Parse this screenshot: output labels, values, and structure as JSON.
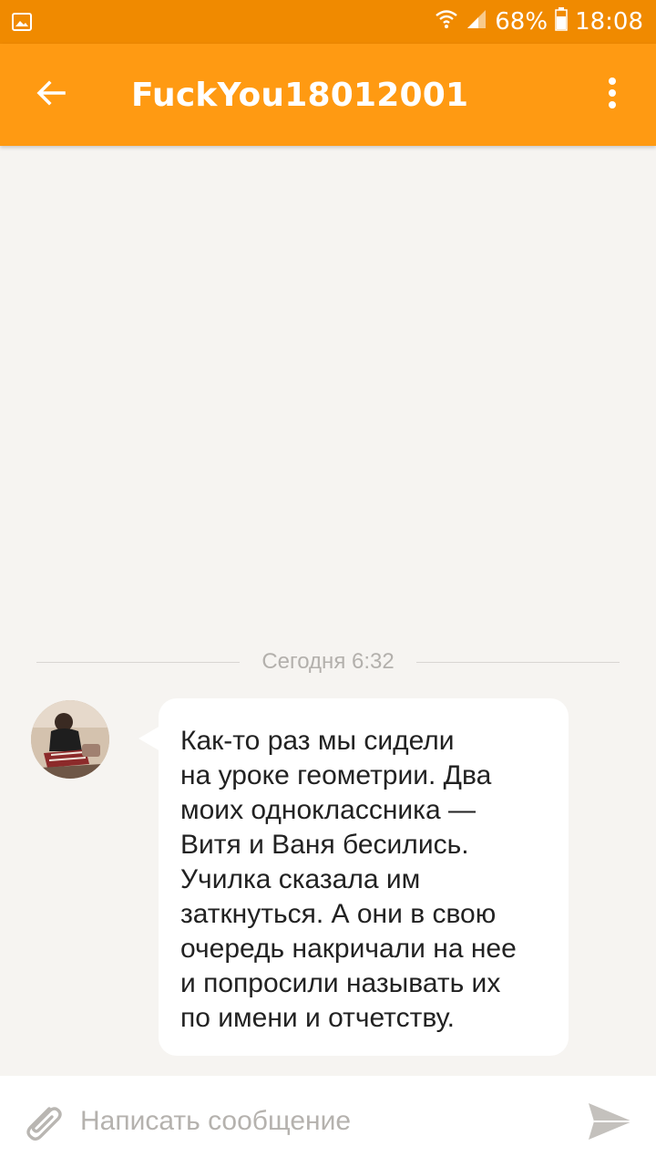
{
  "status_bar": {
    "battery": "68%",
    "time": "18:08",
    "icons": [
      "image-notification-icon",
      "wifi-icon",
      "signal-icon",
      "battery-icon"
    ]
  },
  "header": {
    "title": "FuckYou18012001",
    "back_icon": "back-arrow-icon",
    "menu_icon": "more-vert-icon"
  },
  "chat": {
    "date_label": "Сегодня 6:32",
    "messages": [
      {
        "text": "Как-то раз мы сидели\nна уроке геометрии. Два\nмоих одноклассника —\nВитя и Ваня бесились.\nУчилка сказала им\nзаткнуться. А они в свою\nочередь накричали на нее\nи попросили называть их\nпо имени и отчетству."
      }
    ]
  },
  "composer": {
    "placeholder": "Написать сообщение",
    "attach_icon": "paperclip-icon",
    "send_icon": "send-icon"
  },
  "colors": {
    "status_bar": "#f08a00",
    "app_bar": "#ff9a12",
    "background": "#f6f4f1",
    "bubble": "#ffffff"
  }
}
